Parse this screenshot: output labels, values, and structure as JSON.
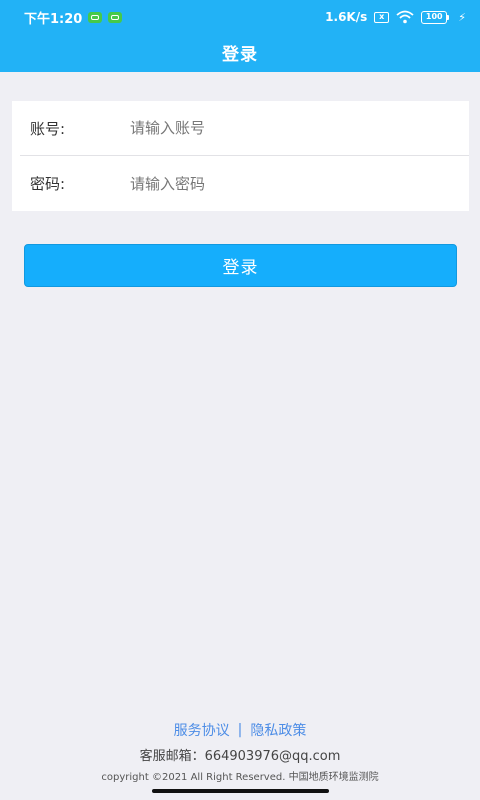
{
  "status_bar": {
    "time": "下午1:20",
    "network_speed": "1.6K/s",
    "sim_label": "x",
    "battery": "100",
    "bolt": "⚡"
  },
  "header": {
    "title": "登录"
  },
  "form": {
    "account_label": "账号:",
    "account_placeholder": "请输入账号",
    "password_label": "密码:",
    "password_placeholder": "请输入密码"
  },
  "login_button": "登录",
  "footer": {
    "service_agreement": "服务协议",
    "separator": "|",
    "privacy_policy": "隐私政策",
    "email": "客服邮箱：664903976@qq.com",
    "copyright": "copyright ©2021 All Right Reserved. 中国地质环境监测院"
  },
  "colors": {
    "header_bg": "#22b2f6",
    "button_bg": "#15aefc",
    "link": "#4d8de6",
    "page_bg": "#efeff4"
  }
}
